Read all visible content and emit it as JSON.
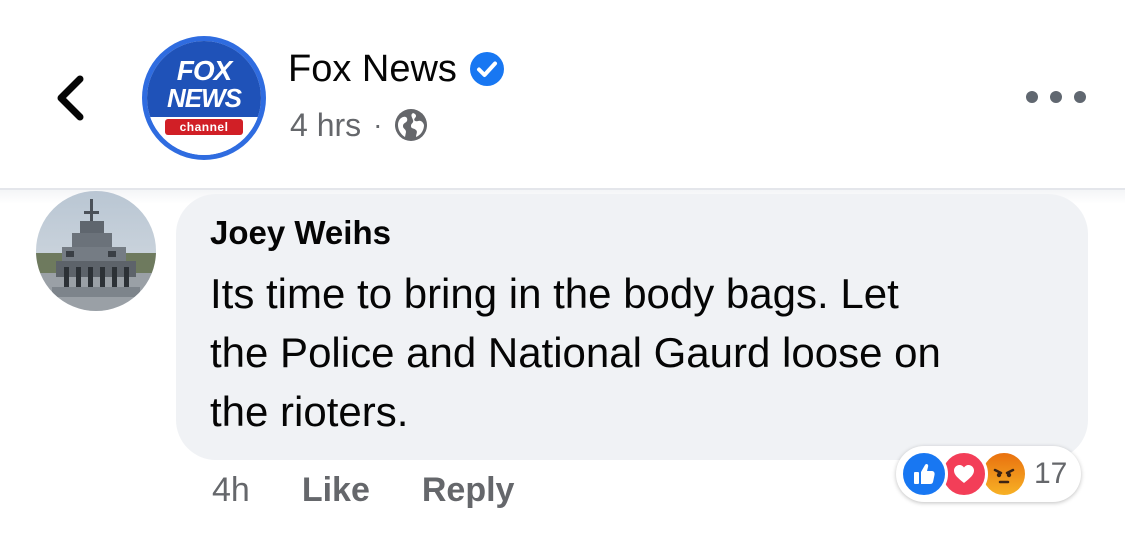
{
  "post_header": {
    "back_icon": "chevron-left-icon",
    "page_logo": {
      "line1": "FOX",
      "line2": "NEWS",
      "line3": "channel",
      "colors": {
        "blue": "#1f52b8",
        "ring": "#2f6ce0",
        "red": "#d11f26"
      }
    },
    "page_name": "Fox News",
    "verified_icon": "verified-badge-icon",
    "time": "4 hrs",
    "separator": "·",
    "audience_icon": "globe-icon",
    "more_icon": "more-horizontal-icon"
  },
  "comment": {
    "author": "Joey Weihs",
    "text_lines": [
      "Its time to bring in the body bags. Let",
      "the Police and National Gaurd loose on",
      "the rioters."
    ],
    "time": "4h",
    "like_label": "Like",
    "reply_label": "Reply",
    "reactions": {
      "icons": [
        "like-reaction-icon",
        "love-reaction-icon",
        "angry-reaction-icon"
      ],
      "count": "17"
    }
  },
  "colors": {
    "bubble": "#f0f2f5",
    "secondary_text": "#65676b",
    "verified_blue": "#1877f2"
  }
}
